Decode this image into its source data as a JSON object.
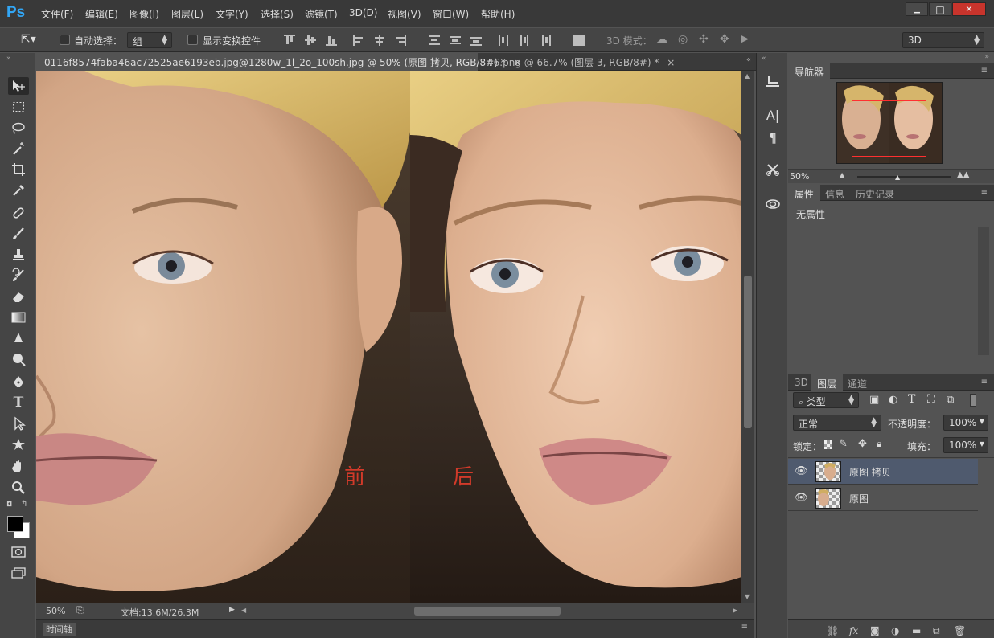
{
  "app": {
    "logo": "Ps"
  },
  "menu": [
    "文件(F)",
    "编辑(E)",
    "图像(I)",
    "图层(L)",
    "文字(Y)",
    "选择(S)",
    "滤镜(T)",
    "3D(D)",
    "视图(V)",
    "窗口(W)",
    "帮助(H)"
  ],
  "window_controls": {
    "minimize": "▁",
    "maximize": "□",
    "close": "✕"
  },
  "options": {
    "auto_select_label": "自动选择：",
    "auto_select_value": "组",
    "show_transform_label": "显示变换控件",
    "mode_3d_label": "3D 模式：",
    "workspace": "3D"
  },
  "tabs": [
    {
      "title": "0116f8574faba46ac72525ae6193eb.jpg@1280w_1l_2o_100sh.jpg @ 50% (原图 拷贝, RGB/8#) *",
      "close": "×"
    },
    {
      "title": "46.png @ 66.7% (图层 3, RGB/8#) *",
      "close": "×"
    }
  ],
  "canvas": {
    "label_before": "前",
    "label_after": "后",
    "label_color": "#d23a2a"
  },
  "status": {
    "zoom": "50%",
    "doc": "文档:13.6M/26.3M"
  },
  "timeline": {
    "label": "时间轴"
  },
  "navigator": {
    "tab": "导航器",
    "zoom": "50%"
  },
  "properties": {
    "tabs": [
      "属性",
      "信息",
      "历史记录"
    ],
    "content": "无属性"
  },
  "layers_panel": {
    "tabs": [
      "3D",
      "图层",
      "通道"
    ],
    "filter": "类型",
    "blend_mode": "正常",
    "opacity_label": "不透明度：",
    "opacity_value": "100%",
    "lock_label": "锁定：",
    "fill_label": "填充：",
    "fill_value": "100%",
    "layers": [
      {
        "name": "原图 拷贝",
        "selected": true
      },
      {
        "name": "原图",
        "selected": false
      }
    ]
  },
  "colors": {
    "accent": "#32a6f5",
    "selection_layer": "#4f5a6e",
    "nav_frame": "#ff3030"
  }
}
